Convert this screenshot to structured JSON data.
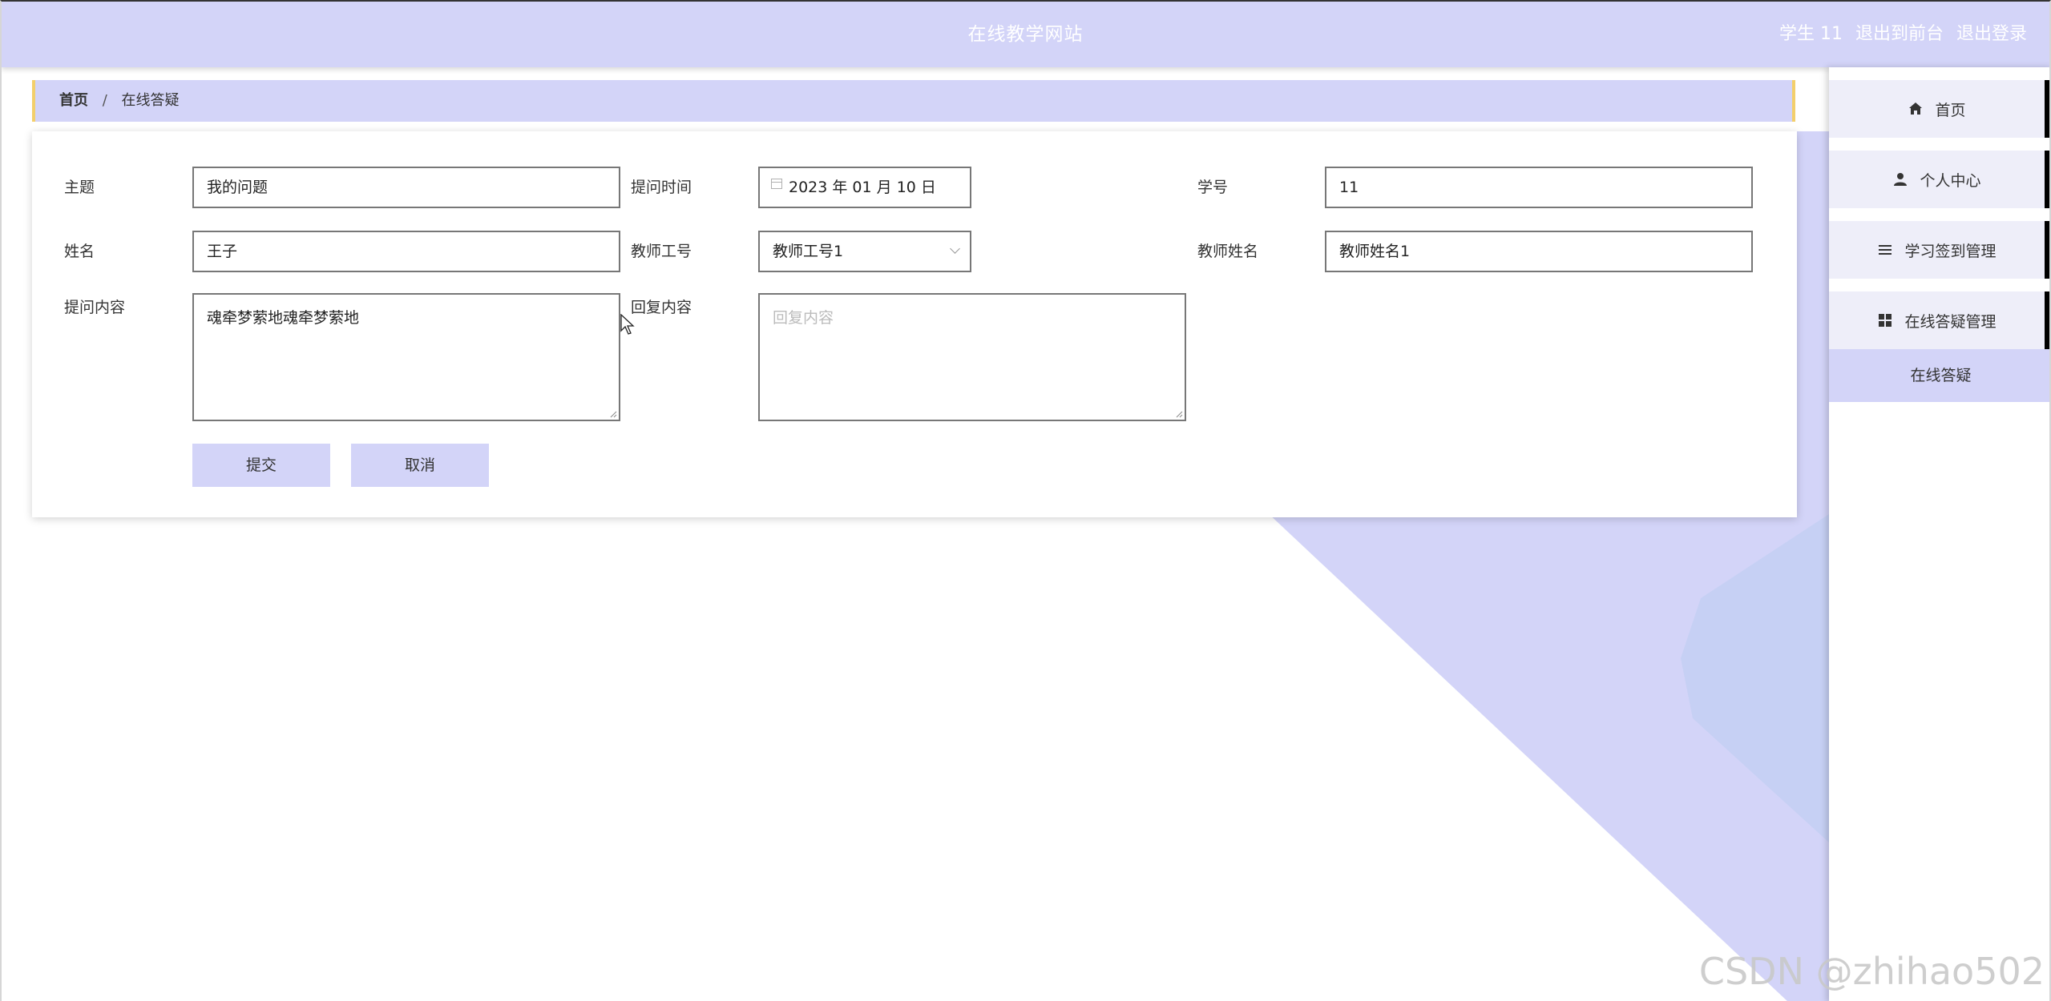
{
  "header": {
    "site_title": "在线教学网站",
    "user_label": "学生 11",
    "front_link": "退出到前台",
    "logout_link": "退出登录"
  },
  "breadcrumb": {
    "home": "首页",
    "separator": "/",
    "current": "在线答疑"
  },
  "form": {
    "subject": {
      "label": "主题",
      "value": "我的问题"
    },
    "ask_time": {
      "label": "提问时间",
      "value": "2023 年 01 月 10 日"
    },
    "student_no": {
      "label": "学号",
      "value": "11"
    },
    "name": {
      "label": "姓名",
      "value": "王子"
    },
    "teacher_no": {
      "label": "教师工号",
      "value": "教师工号1"
    },
    "teacher_name": {
      "label": "教师姓名",
      "value": "教师姓名1"
    },
    "question": {
      "label": "提问内容",
      "value": "魂牵梦萦地魂牵梦萦地"
    },
    "reply": {
      "label": "回复内容",
      "placeholder": "回复内容"
    },
    "submit_label": "提交",
    "cancel_label": "取消"
  },
  "sidebar": {
    "items": [
      {
        "label": "首页",
        "icon": "home-icon"
      },
      {
        "label": "个人中心",
        "icon": "user-icon"
      },
      {
        "label": "学习签到管理",
        "icon": "list-icon"
      },
      {
        "label": "在线答疑管理",
        "icon": "grid-icon"
      }
    ],
    "subitem": "在线答疑"
  },
  "watermark": "CSDN @zhihao502",
  "colors": {
    "accent": "#d3d4f8",
    "breadcrumb_border": "#f3cf6c",
    "decor_light": "#d3d4f8",
    "decor_blue": "#c6d0f4"
  }
}
